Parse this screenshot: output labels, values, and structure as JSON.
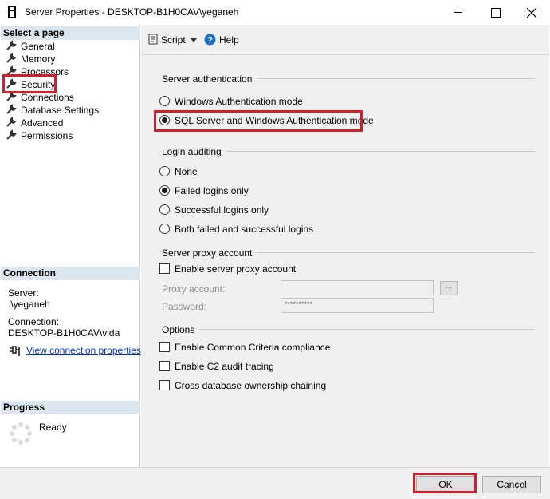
{
  "window": {
    "title": "Server Properties - DESKTOP-B1H0CAV\\yeganeh"
  },
  "left": {
    "select_page_header": "Select a page",
    "pages": [
      {
        "label": "General"
      },
      {
        "label": "Memory"
      },
      {
        "label": "Processors"
      },
      {
        "label": "Security",
        "selected": true
      },
      {
        "label": "Connections"
      },
      {
        "label": "Database Settings"
      },
      {
        "label": "Advanced"
      },
      {
        "label": "Permissions"
      }
    ],
    "connection_header": "Connection",
    "server_label": "Server:",
    "server_value": ".\\yeganeh",
    "connection_label": "Connection:",
    "connection_value": "DESKTOP-B1H0CAV\\vida",
    "view_connection_link": "View connection properties",
    "progress_header": "Progress",
    "progress_status": "Ready"
  },
  "toolbar": {
    "script_label": "Script",
    "help_label": "Help"
  },
  "server_authentication": {
    "group_label": "Server authentication",
    "options": [
      {
        "label": "Windows Authentication mode",
        "selected": false
      },
      {
        "label": "SQL Server and Windows Authentication mode",
        "selected": true
      }
    ]
  },
  "login_auditing": {
    "group_label": "Login auditing",
    "options": [
      {
        "label": "None",
        "selected": false
      },
      {
        "label": "Failed logins only",
        "selected": true
      },
      {
        "label": "Successful logins only",
        "selected": false
      },
      {
        "label": "Both failed and successful logins",
        "selected": false
      }
    ]
  },
  "server_proxy": {
    "group_label": "Server proxy account",
    "enable_label": "Enable server proxy account",
    "enabled": false,
    "proxy_account_label": "Proxy account:",
    "proxy_account_value": "",
    "password_label": "Password:",
    "password_value": "**********",
    "browse_label": "..."
  },
  "options": {
    "group_label": "Options",
    "items": [
      {
        "label": "Enable Common Criteria compliance",
        "checked": false
      },
      {
        "label": "Enable C2 audit tracing",
        "checked": false
      },
      {
        "label": "Cross database ownership chaining",
        "checked": false
      }
    ]
  },
  "buttons": {
    "ok_label": "OK",
    "cancel_label": "Cancel"
  },
  "colors": {
    "highlight_border": "#d21f2b",
    "section_header_bg": "#dce6f0",
    "link": "#0033cc"
  }
}
